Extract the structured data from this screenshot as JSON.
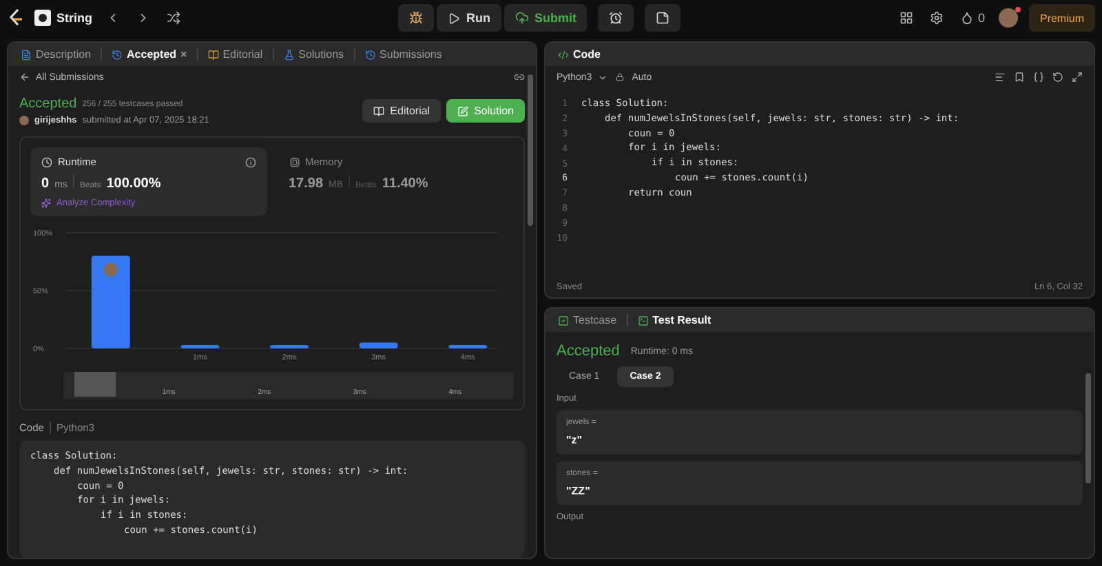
{
  "topbar": {
    "problem": "String",
    "run": "Run",
    "submit": "Submit",
    "streak": "0",
    "premium": "Premium"
  },
  "left": {
    "tabs": [
      {
        "label": "Description",
        "selected": false,
        "closable": false
      },
      {
        "label": "Accepted",
        "selected": true,
        "closable": true,
        "close": "×"
      },
      {
        "label": "Editorial",
        "selected": false,
        "closable": false
      },
      {
        "label": "Solutions",
        "selected": false,
        "closable": false
      },
      {
        "label": "Submissions",
        "selected": false,
        "closable": false
      }
    ],
    "back": "All Submissions",
    "status": "Accepted",
    "passed": "256 / 255 testcases passed",
    "user": "girijeshhs",
    "submitted": "submitted at Apr 07, 2025 18:21",
    "buttons": [
      {
        "label": "Editorial",
        "kind": "secondary"
      },
      {
        "label": "Solution",
        "kind": "primary"
      }
    ],
    "stats": [
      {
        "title": "Runtime",
        "value": "0",
        "unit": "ms",
        "beats_label": "Beats",
        "beats": "100.00%",
        "selected": true,
        "link": "Analyze Complexity"
      },
      {
        "title": "Memory",
        "value": "17.98",
        "unit": "MB",
        "beats_label": "Beats",
        "beats": "11.40%",
        "selected": false
      }
    ],
    "chart_data": {
      "type": "bar",
      "categories": [
        null,
        "1ms",
        "2ms",
        "3ms",
        "4ms"
      ],
      "values": [
        80,
        3,
        3,
        5,
        3
      ],
      "ylim": [
        0,
        100
      ],
      "yticks": [
        {
          "value": 0,
          "label": "0%"
        },
        {
          "value": 50,
          "label": "50%"
        },
        {
          "value": 100,
          "label": "100%"
        }
      ]
    },
    "minimap": [
      "1ms",
      "2ms",
      "3ms",
      "4ms"
    ],
    "code_label": "Code",
    "language": "Python3",
    "code": [
      {
        "text": "class Solution:",
        "children": [
          {
            "text": "def numJewelsInStones(self, jewels: str, stones: str) -> int:",
            "children": [
              {
                "text": "coun = 0"
              },
              {
                "text": "for i in jewels:",
                "children": [
                  {
                    "text": "if i in stones:",
                    "children": [
                      {
                        "text": "coun += stones.count(i)"
                      }
                    ]
                  }
                ]
              }
            ]
          }
        ]
      }
    ]
  },
  "editor": {
    "title": "Code",
    "language": "Python3",
    "mode": "Auto",
    "line_numbers": [
      {
        "number": "1",
        "current": false
      },
      {
        "number": "2",
        "current": false
      },
      {
        "number": "3",
        "current": false
      },
      {
        "number": "4",
        "current": false
      },
      {
        "number": "5",
        "current": false
      },
      {
        "number": "6",
        "current": true
      },
      {
        "number": "7",
        "current": false
      },
      {
        "number": "8",
        "current": false
      },
      {
        "number": "9",
        "current": false
      },
      {
        "number": "10",
        "current": false
      }
    ],
    "code": [
      {
        "text": "class Solution:",
        "children": [
          {
            "text": "def numJewelsInStones(self, jewels: str, stones: str) -> int:",
            "children": [
              {
                "text": "coun = 0"
              },
              {
                "text": "for i in jewels:",
                "children": [
                  {
                    "text": "if i in stones:",
                    "children": [
                      {
                        "text": "coun += stones.count(i)"
                      }
                    ]
                  }
                ]
              },
              {
                "text": "return coun"
              }
            ]
          }
        ]
      }
    ],
    "saved": "Saved",
    "position": "Ln 6, Col 32"
  },
  "result": {
    "tabs": [
      {
        "label": "Testcase",
        "selected": false
      },
      {
        "label": "Test Result",
        "selected": true
      }
    ],
    "status": "Accepted",
    "runtime": "Runtime: 0 ms",
    "cases": [
      {
        "label": "Case 1",
        "selected": false
      },
      {
        "label": "Case 2",
        "selected": true
      }
    ],
    "input_label": "Input",
    "inputs": [
      {
        "name": "jewels =",
        "value": "\"z\""
      },
      {
        "name": "stones =",
        "value": "\"ZZ\""
      }
    ],
    "output_label": "Output"
  }
}
